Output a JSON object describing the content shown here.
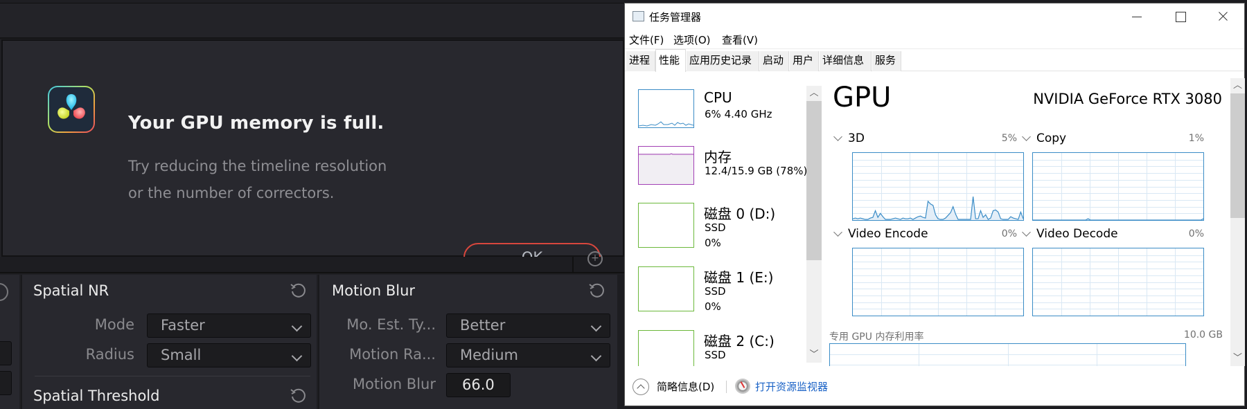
{
  "resolve": {
    "dialog": {
      "title": "Your GPU memory is full.",
      "message_line1": "Try reducing the timeline resolution",
      "message_line2": "or the number of correctors.",
      "ok_label": "OK",
      "accent_color": "#d8473d"
    },
    "spatial_nr": {
      "title": "Spatial NR",
      "mode_label": "Mode",
      "mode_value": "Faster",
      "radius_label": "Radius",
      "radius_value": "Small"
    },
    "spatial_threshold": {
      "title": "Spatial Threshold"
    },
    "motion_blur": {
      "title": "Motion Blur",
      "est_type_label": "Mo. Est. Ty...",
      "est_type_value": "Better",
      "motion_range_label": "Motion Ra...",
      "motion_range_value": "Medium",
      "motion_blur_label": "Motion Blur",
      "motion_blur_value": "66.0"
    }
  },
  "task_manager": {
    "title": "任务管理器",
    "menu": [
      "文件(F)",
      "选项(O)",
      "查看(V)"
    ],
    "tabs": [
      "进程",
      "性能",
      "应用历史记录",
      "启动",
      "用户",
      "详细信息",
      "服务"
    ],
    "active_tab": "性能",
    "sidebar": [
      {
        "name": "CPU",
        "sub1": "6%  4.40 GHz",
        "sub2": "",
        "color": "#3a8cc6"
      },
      {
        "name": "内存",
        "sub1": "12.4/15.9 GB (78%)",
        "sub2": "",
        "color": "#a23fb4"
      },
      {
        "name": "磁盘 0 (D:)",
        "sub1": "SSD",
        "sub2": "0%",
        "color": "#6bb83a"
      },
      {
        "name": "磁盘 1 (E:)",
        "sub1": "SSD",
        "sub2": "0%",
        "color": "#6bb83a"
      },
      {
        "name": "磁盘 2 (C:)",
        "sub1": "SSD",
        "sub2": "",
        "color": "#6bb83a"
      }
    ],
    "gpu": {
      "heading": "GPU",
      "model": "NVIDIA GeForce RTX 3080",
      "engines": [
        {
          "label": "3D",
          "percent": "5%"
        },
        {
          "label": "Copy",
          "percent": "1%"
        },
        {
          "label": "Video Encode",
          "percent": "0%"
        },
        {
          "label": "Video Decode",
          "percent": "0%"
        }
      ],
      "dedicated_memory_label": "专用 GPU 内存利用率",
      "dedicated_memory_max": "10.0 GB",
      "graph_color": "#3a8cc6",
      "series_3d": [
        2,
        3,
        2,
        3,
        2,
        1,
        1,
        3,
        4,
        14,
        4,
        10,
        5,
        1,
        1,
        1,
        2,
        3,
        2,
        1,
        3,
        2,
        2,
        3,
        1,
        3,
        5,
        6,
        4,
        3,
        28,
        24,
        22,
        8,
        2,
        1,
        1,
        3,
        7,
        11,
        20,
        9,
        1,
        1,
        1,
        1,
        1,
        1,
        35,
        2,
        2,
        14,
        4,
        8,
        1,
        3,
        14,
        15,
        12,
        2,
        1,
        1,
        1,
        5,
        3,
        2,
        1,
        12,
        2
      ],
      "series_copy": [
        0,
        0,
        0,
        0,
        0,
        0,
        0,
        0,
        0,
        0,
        0,
        0,
        0,
        0,
        0,
        0,
        0,
        0,
        0,
        0,
        0,
        0,
        2,
        0,
        0,
        0,
        0,
        0,
        0,
        0,
        0,
        0,
        0,
        0,
        0,
        0,
        0,
        0,
        0,
        0,
        0,
        0,
        0,
        0,
        0,
        0,
        0,
        0,
        0,
        0,
        0,
        0,
        0,
        0,
        0,
        0,
        0,
        0,
        0,
        0,
        0,
        0,
        0,
        0,
        0,
        0,
        0,
        0,
        2
      ]
    },
    "footer": {
      "fewer_details": "简略信息(D)",
      "open_resource_monitor": "打开资源监视器"
    }
  }
}
